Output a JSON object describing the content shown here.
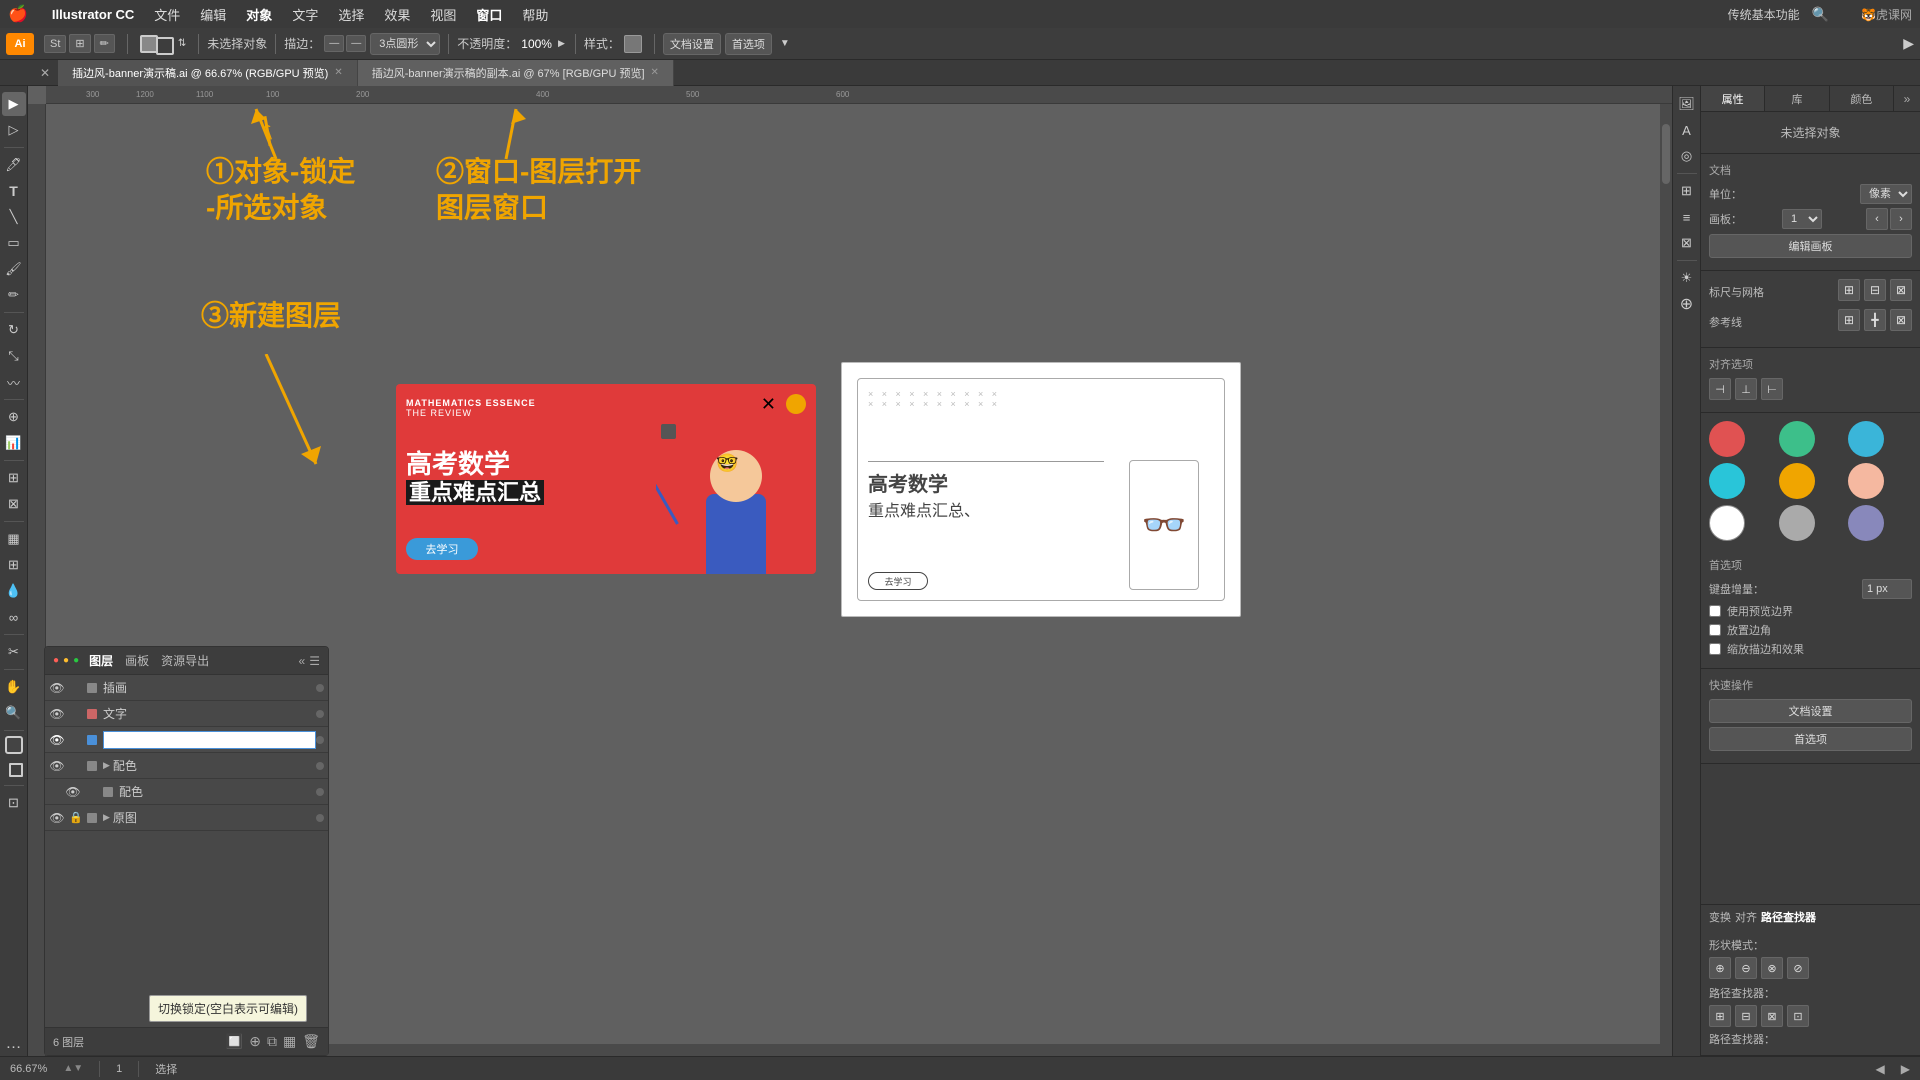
{
  "app": {
    "name": "Illustrator CC",
    "logo": "Ai"
  },
  "menubar": {
    "apple": "🍎",
    "items": [
      "文件",
      "编辑",
      "对象",
      "文字",
      "选择",
      "效果",
      "视图",
      "窗口",
      "帮助"
    ],
    "app_name": "Illustrator CC",
    "right": {
      "mode": "传统基本功能",
      "search_icon": "🔍"
    }
  },
  "toolbar": {
    "no_select_label": "未选择对象",
    "stroke_label": "描边：",
    "stroke_value": "3点圆形",
    "opacity_label": "不透明度：",
    "opacity_value": "100%",
    "style_label": "样式：",
    "doc_settings": "文档设置",
    "preferences": "首选项",
    "arrow_btn": "▼"
  },
  "tabbar": {
    "tabs": [
      {
        "name": "插边风-banner演示稿.ai @ 66.67% (RGB/GPU 预览)",
        "active": true
      },
      {
        "name": "插边风-banner演示稿的副本.ai @ 67% [RGB/GPU 预览]",
        "active": false
      }
    ]
  },
  "annotations": {
    "step1": {
      "number": "①",
      "text": "对象-锁定\n-所选对象",
      "arrow_direction": "up"
    },
    "step2": {
      "number": "②",
      "text": "窗口-图层打开\n图层窗口",
      "arrow_direction": "up"
    },
    "step3": {
      "number": "③",
      "text": "新建图层",
      "arrow_direction": "down-right"
    }
  },
  "canvas": {
    "zoom": "66.67%",
    "mode": "选择",
    "rulers": {
      "h_marks": [
        "300",
        "1200",
        "1100",
        "100",
        "200",
        "400",
        "500",
        "600"
      ],
      "v_marks": []
    }
  },
  "layers_panel": {
    "title": "图层",
    "tabs": [
      "图层",
      "画板",
      "资源导出"
    ],
    "active_tab": "图层",
    "layers": [
      {
        "name": "插画",
        "visible": true,
        "locked": false,
        "color": "#888",
        "editing": false
      },
      {
        "name": "文字",
        "visible": true,
        "locked": false,
        "color": "#888",
        "editing": false
      },
      {
        "name": "",
        "visible": true,
        "locked": false,
        "color": "#4a90d9",
        "editing": true
      },
      {
        "name": "配色",
        "visible": true,
        "locked": false,
        "color": "#888",
        "has_arrow": true,
        "editing": false
      },
      {
        "name": "配色",
        "visible": true,
        "locked": false,
        "color": "#888",
        "editing": false
      },
      {
        "name": "原图",
        "visible": true,
        "locked": true,
        "color": "#888",
        "editing": false
      }
    ],
    "footer": {
      "count": "6 图层",
      "btns": [
        "🔲",
        "⊕",
        "⧉",
        "▦",
        "🗑"
      ]
    }
  },
  "tooltip": {
    "text": "切换锁定(空白表示可编辑)"
  },
  "right_panel": {
    "tabs": [
      "属性",
      "库",
      "颜色"
    ],
    "active_tab": "属性",
    "no_selection": "未选择对象",
    "document_section": {
      "title": "文档",
      "unit_label": "单位：",
      "unit_value": "像素",
      "board_label": "画板：",
      "board_value": "1",
      "edit_btn": "编辑画板"
    },
    "scale_grid": {
      "title": "标尺与网格",
      "icons": [
        "grid1",
        "grid2",
        "grid3"
      ]
    },
    "guide_lines": {
      "title": "参考线",
      "icons": [
        "guide1",
        "guide2",
        "guide3"
      ]
    },
    "align_section": {
      "title": "对齐选项",
      "icons": [
        "align1",
        "align2",
        "align3"
      ]
    },
    "preferences": {
      "title": "首选项",
      "keyboard_increment_label": "键盘增量：",
      "keyboard_increment_value": "1 px",
      "checkboxes": [
        {
          "label": "使用预览边界",
          "checked": false
        },
        {
          "label": "放置边角",
          "checked": false
        },
        {
          "label": "缩放描边和效果",
          "checked": false
        }
      ]
    },
    "quick_actions": {
      "title": "快速操作",
      "buttons": [
        "文档设置",
        "首选项"
      ]
    },
    "colors": [
      "#e05252",
      "#3dbf8a",
      "#3ab5d9",
      "#29c5d9",
      "#f0a500",
      "#f5b8a0",
      "#ffffff",
      "#aaaaaa",
      "#8888bb"
    ]
  },
  "bottom_panel": {
    "title": "路径查找器",
    "transform_tab": "变换",
    "align_tab": "对齐",
    "pathfinder_tab": "路径查找器",
    "shape_mode_label": "形状模式：",
    "pathfinder_label": "路径查找器："
  },
  "statusbar": {
    "zoom": "66.67%",
    "page": "1",
    "mode": "选择"
  },
  "banner_red": {
    "top_text1": "MATHEMATICS ESSENCE",
    "top_text2": "THE REVIEW",
    "main_text1": "高考数学",
    "main_text2": "重点难点汇总",
    "btn_text": "去学习"
  },
  "sketch": {
    "title1": "高考数学",
    "title2": "重点难点汇总、",
    "btn_text": "去学习"
  }
}
